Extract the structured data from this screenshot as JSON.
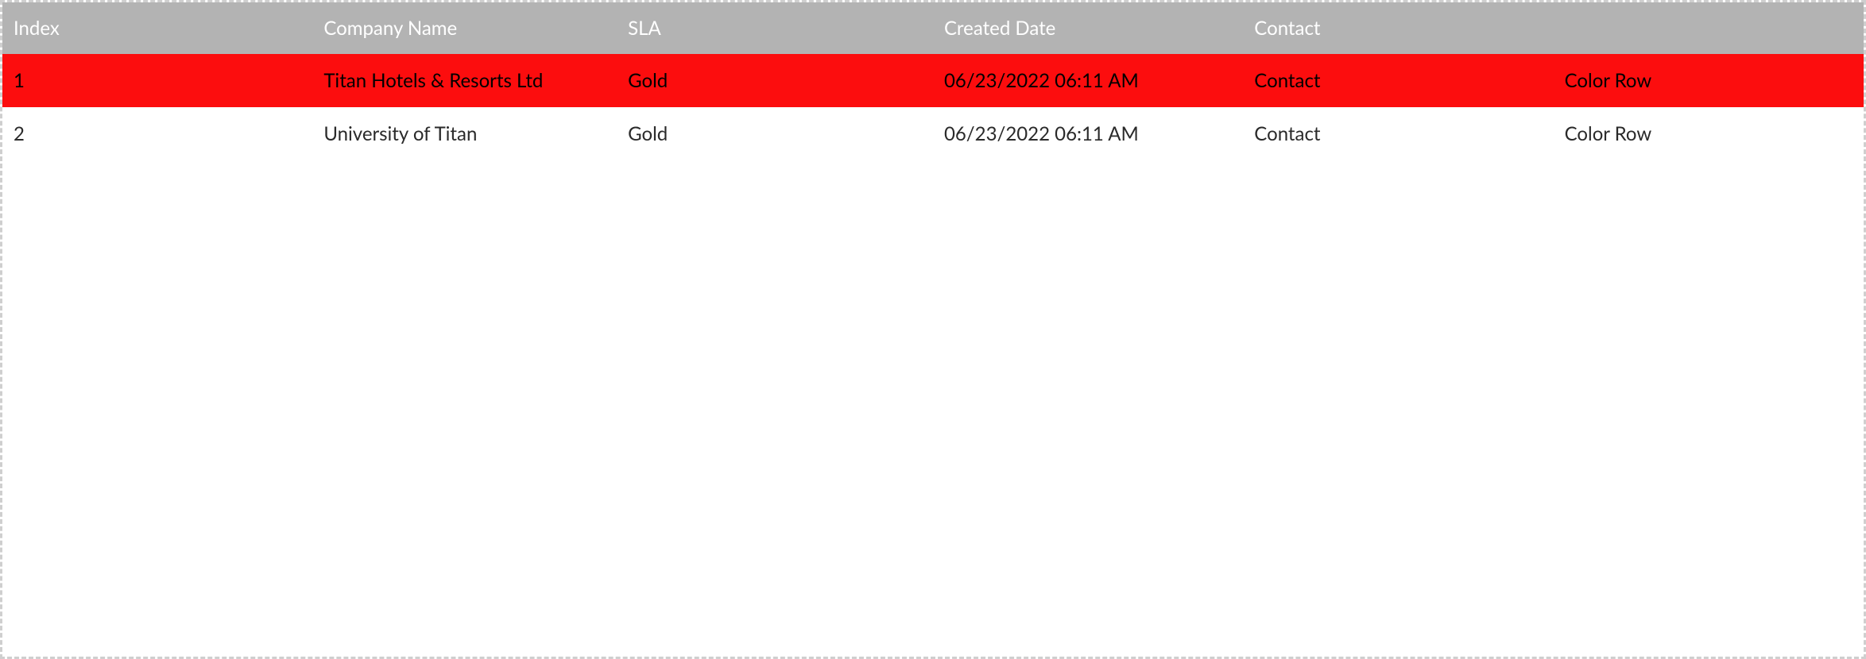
{
  "colors": {
    "header_bg": "#b3b3b3",
    "row_highlight": "#fc0d0e"
  },
  "table": {
    "headers": {
      "index": "Index",
      "company": "Company Name",
      "sla": "SLA",
      "created": "Created Date",
      "contact": "Contact",
      "color_row": ""
    },
    "action_labels": {
      "contact": "Contact",
      "color_row": "Color Row"
    },
    "rows": [
      {
        "index": "1",
        "company": "Titan Hotels & Resorts Ltd",
        "sla": "Gold",
        "created": "06/23/2022 06:11 AM",
        "highlighted": true
      },
      {
        "index": "2",
        "company": "University of Titan",
        "sla": "Gold",
        "created": "06/23/2022 06:11 AM",
        "highlighted": false
      }
    ]
  }
}
